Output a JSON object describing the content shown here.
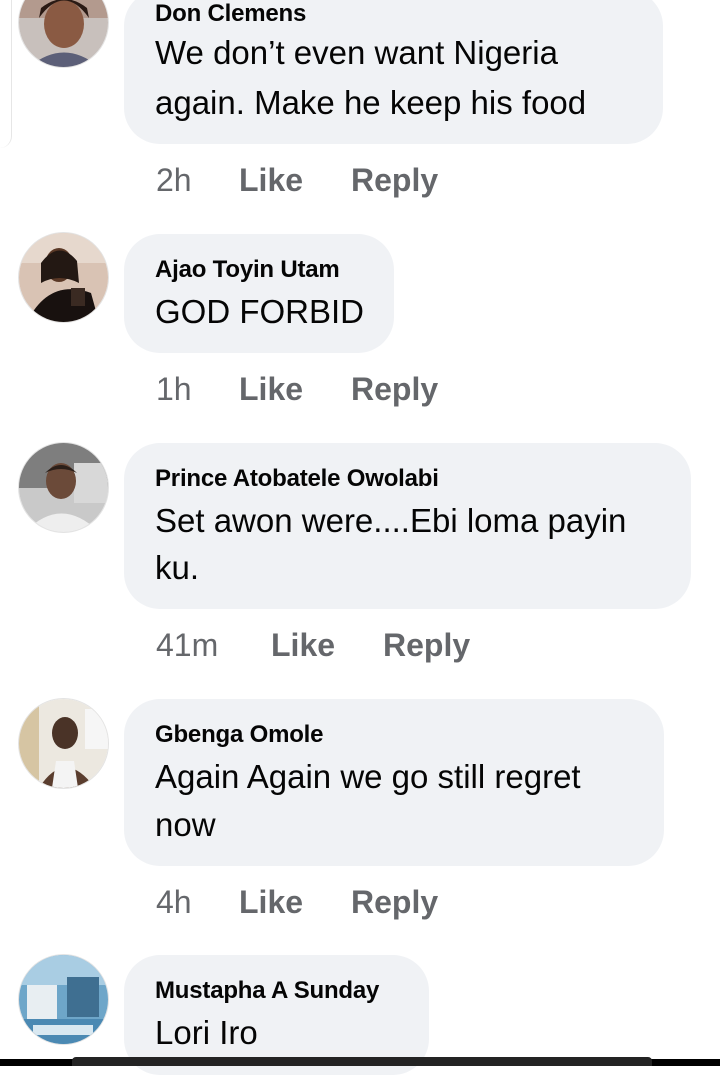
{
  "comments": [
    {
      "author": "Don Clemens",
      "lines": [
        "We don’t even want Nigeria",
        "again. Make he keep his food"
      ],
      "time": "2h",
      "like": "Like",
      "reply": "Reply",
      "avatar_icon": "profile-photo"
    },
    {
      "author": "Ajao Toyin Utam",
      "lines": [
        "GOD FORBID"
      ],
      "time": "1h",
      "like": "Like",
      "reply": "Reply",
      "avatar_icon": "profile-photo"
    },
    {
      "author": "Prince Atobatele Owolabi",
      "lines": [
        "Set awon were....Ebi loma payin",
        "ku."
      ],
      "time": "41m",
      "like": "Like",
      "reply": "Reply",
      "avatar_icon": "profile-photo"
    },
    {
      "author": "Gbenga Omole",
      "lines": [
        "Again  Again we go still regret",
        "now"
      ],
      "time": "4h",
      "like": "Like",
      "reply": "Reply",
      "avatar_icon": "profile-photo"
    },
    {
      "author": "Mustapha A Sunday",
      "lines": [
        "Lori Iro"
      ],
      "avatar_icon": "profile-photo"
    }
  ],
  "colors": {
    "bubble": "#f0f2f5",
    "meta_text": "#65676b",
    "text": "#050505"
  }
}
